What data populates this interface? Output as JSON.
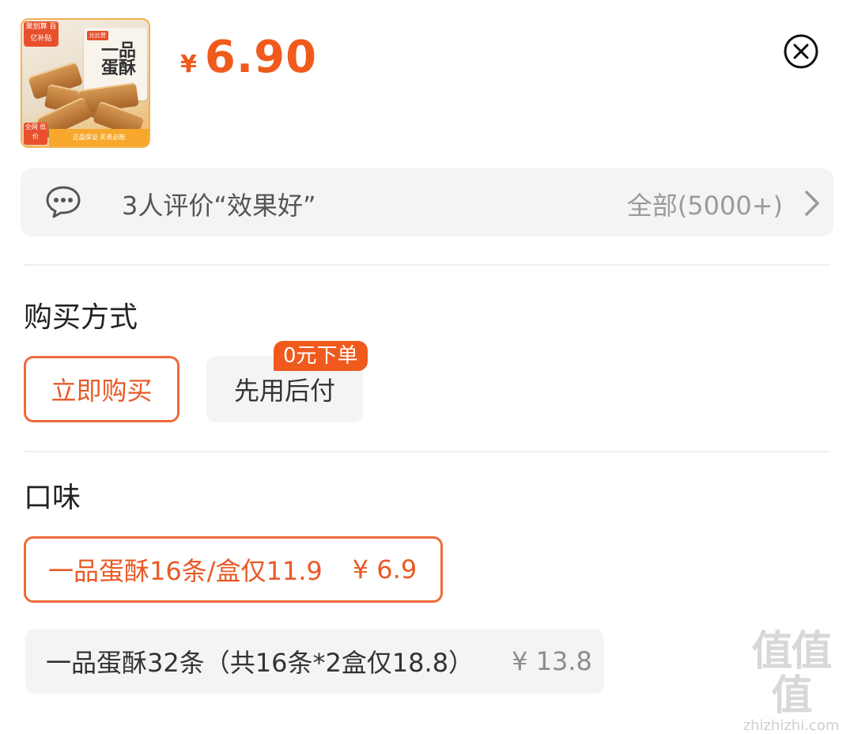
{
  "product": {
    "thumbnail": {
      "tag_top": "聚划算 百亿补贴",
      "brand_mini": "比比赞",
      "box_title": "一品蛋酥",
      "tag_bottom_left": "全网 低价",
      "tag_bottom": "正品保证  买贵必赔"
    },
    "price_currency": "¥",
    "price_amount": "6.90",
    "close_icon": "close-circle-icon"
  },
  "reviews": {
    "icon": "chat-bubble-icon",
    "summary": "3人评价“效果好”",
    "all_label": "全部(5000+)",
    "chevron_icon": "chevron-right-icon"
  },
  "purchase": {
    "title": "购买方式",
    "options": [
      {
        "label": "立即购买",
        "selected": true
      },
      {
        "label": "先用后付",
        "selected": false,
        "badge": "0元下单"
      }
    ]
  },
  "flavor": {
    "title": "口味",
    "options": [
      {
        "label": "一品蛋酥16条/盒仅11.9",
        "price": "¥ 6.9",
        "selected": true
      },
      {
        "label": "一品蛋酥32条（共16条*2盒仅18.8）",
        "price": "¥ 13.8",
        "selected": false
      }
    ]
  },
  "watermark": {
    "main": "值值值",
    "sub": "zhizhizhi.com"
  },
  "colors": {
    "accent": "#f05a1d",
    "selected_border": "#ef6a3a",
    "panel_bg": "#f4f4f4"
  }
}
